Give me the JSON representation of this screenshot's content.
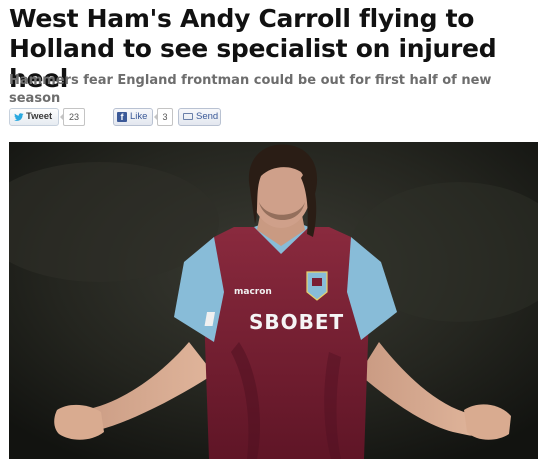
{
  "article": {
    "headline": "West Ham's Andy Carroll flying to Holland to see specialist on injured heel",
    "subheadline": "Hammers fear England frontman could be out for first half of new season"
  },
  "share": {
    "tweet_label": "Tweet",
    "tweet_count": "23",
    "like_label": "Like",
    "like_count": "3",
    "send_label": "Send"
  },
  "photo": {
    "shirt_sponsor": "SBOBET",
    "shirt_maker": "macron"
  },
  "colors": {
    "headline": "#111111",
    "subheadline": "#6d6d6d",
    "facebook": "#3b5998",
    "twitter": "#2aa9e0",
    "claret": "#7a1e34",
    "sky_blue": "#88bcd8"
  },
  "icons": [
    "twitter-bird-icon",
    "facebook-icon",
    "envelope-icon"
  ]
}
